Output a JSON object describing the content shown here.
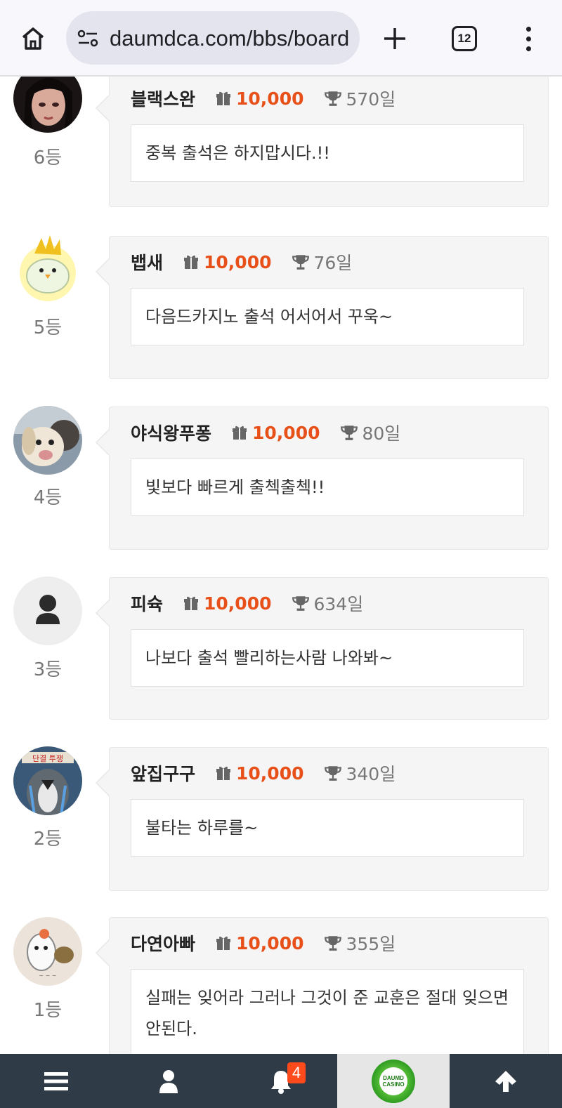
{
  "browser": {
    "url": "daumdca.com/bbs/board",
    "tab_count": "12"
  },
  "entries": [
    {
      "nickname": "블랙스완",
      "points": "10,000",
      "days": "570일",
      "rank": "6등",
      "message": "중복 출석은 하지맙시다.!!",
      "avatar": "dark-portrait"
    },
    {
      "nickname": "뱁새",
      "points": "10,000",
      "days": "76일",
      "rank": "5등",
      "message": "다음드카지노 출석 어서어서 꾸욱~",
      "avatar": "chick-character"
    },
    {
      "nickname": "야식왕푸퐁",
      "points": "10,000",
      "days": "80일",
      "rank": "4등",
      "message": "빛보다 빠르게 출첵출첵!!",
      "avatar": "dog-photo"
    },
    {
      "nickname": "피슉",
      "points": "10,000",
      "days": "634일",
      "rank": "3등",
      "message": "나보다 출석 빨리하는사람 나와봐~",
      "avatar": "default-user"
    },
    {
      "nickname": "앞집구구",
      "points": "10,000",
      "days": "340일",
      "rank": "2등",
      "message": "불타는 하루를~",
      "avatar": "bird-protest"
    },
    {
      "nickname": "다연아빠",
      "points": "10,000",
      "days": "355일",
      "rank": "1등",
      "message": "실패는 잊어라 그러나 그것이 준 교훈은 절대 잊으면 안된다.",
      "avatar": "hamster-character"
    }
  ],
  "bottom_nav": {
    "notification_count": "4",
    "logo_text_top": "DAUMD",
    "logo_text_bottom": "CASINO"
  },
  "colors": {
    "points": "#e8501a",
    "nav_background": "#2f3b46",
    "card_background": "#f5f5f5"
  }
}
